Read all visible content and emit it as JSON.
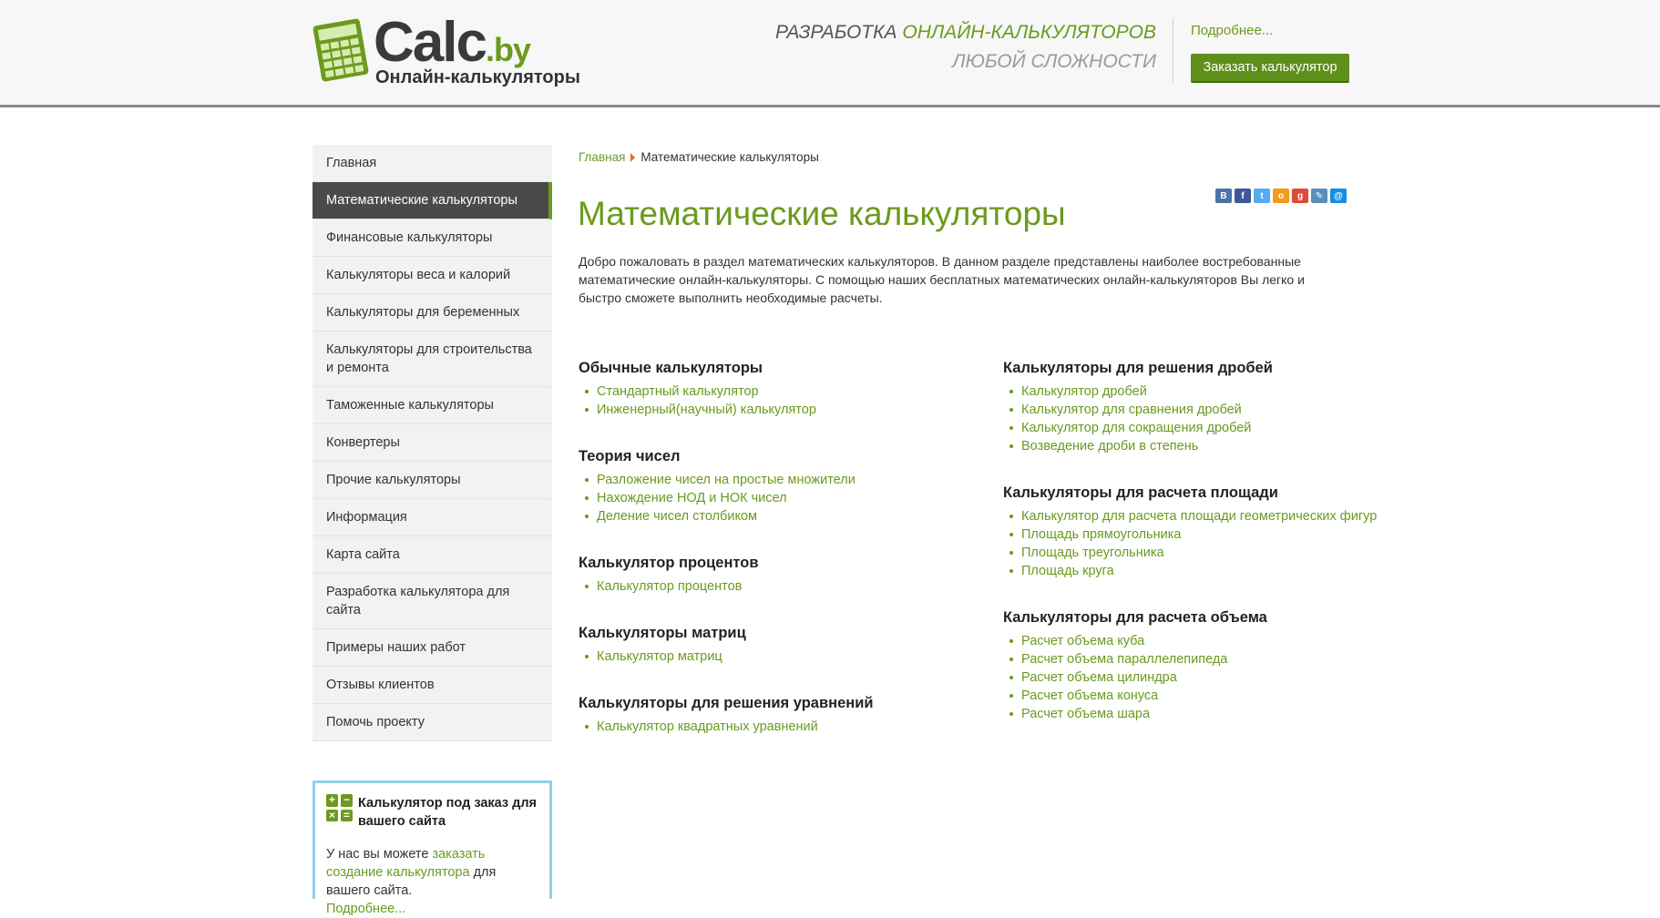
{
  "header": {
    "logo_main": "Calc",
    "logo_tld": ".by",
    "logo_sub": "Онлайн-калькуляторы",
    "slogan_part1": "Разработка ",
    "slogan_part2": "онлайн-калькуляторов",
    "slogan_line2": "любой сложности",
    "more_link": "Подробнее...",
    "order_button": "Заказать калькулятор"
  },
  "sidebar": {
    "items": [
      {
        "label": "Главная"
      },
      {
        "label": "Математические калькуляторы"
      },
      {
        "label": "Финансовые калькуляторы"
      },
      {
        "label": "Калькуляторы веса и калорий"
      },
      {
        "label": "Калькуляторы для беременных"
      },
      {
        "label": "Калькуляторы для строительства и ремонта"
      },
      {
        "label": "Таможенные калькуляторы"
      },
      {
        "label": "Конвертеры"
      },
      {
        "label": "Прочие калькуляторы"
      },
      {
        "label": "Информация"
      },
      {
        "label": "Карта сайта"
      },
      {
        "label": "Разработка калькулятора для сайта"
      },
      {
        "label": "Примеры наших работ"
      },
      {
        "label": "Отзывы клиентов"
      },
      {
        "label": "Помочь проекту"
      }
    ],
    "promo": {
      "title": "Калькулятор под заказ для вашего сайта",
      "text_before": "У нас вы можете ",
      "link": "заказать создание калькулятора",
      "text_after": " для вашего сайта.",
      "more": "Подробнее..."
    }
  },
  "breadcrumb": {
    "home": "Главная",
    "current": "Математические калькуляторы"
  },
  "share_icons": [
    {
      "icon": "vk-icon",
      "glyph": "В",
      "color": "#4c75a3"
    },
    {
      "icon": "facebook-icon",
      "glyph": "f",
      "color": "#3b5998"
    },
    {
      "icon": "twitter-icon",
      "glyph": "t",
      "color": "#55acee"
    },
    {
      "icon": "odnoklassniki-icon",
      "glyph": "o",
      "color": "#f59a1a"
    },
    {
      "icon": "googleplus-icon",
      "glyph": "g",
      "color": "#dd4b39"
    },
    {
      "icon": "livejournal-icon",
      "glyph": "✎",
      "color": "#5b8fb9"
    },
    {
      "icon": "mailru-icon",
      "glyph": "@",
      "color": "#168de2"
    }
  ],
  "main": {
    "title": "Математические калькуляторы",
    "intro": "Добро пожаловать в раздел математических калькуляторов. В данном разделе представлены наиболее востребованные математические онлайн-калькуляторы. С помощью наших бесплатных математических онлайн-калькуляторов Вы легко и быстро сможете выполнить необходимые расчеты.",
    "left_sections": [
      {
        "title": "Обычные калькуляторы",
        "links": [
          "Стандартный калькулятор",
          "Инженерный(научный) калькулятор"
        ]
      },
      {
        "title": "Теория чисел",
        "links": [
          "Разложение чисел на простые множители",
          "Нахождение НОД и НОК чисел",
          "Деление чисел столбиком"
        ]
      },
      {
        "title": "Калькулятор процентов",
        "links": [
          "Калькулятор процентов"
        ]
      },
      {
        "title": "Калькуляторы матриц",
        "links": [
          "Калькулятор матриц"
        ]
      },
      {
        "title": "Калькуляторы для решения уравнений",
        "links": [
          "Калькулятор квадратных уравнений"
        ]
      }
    ],
    "right_sections": [
      {
        "title": "Калькуляторы для решения дробей",
        "links": [
          "Калькулятор дробей",
          "Калькулятор для сравнения дробей",
          "Калькулятор для сокращения дробей",
          "Возведение дроби в степень"
        ]
      },
      {
        "title": "Калькуляторы для расчета площади",
        "links": [
          "Калькулятор для расчета площади геометрических фигур",
          "Площадь прямоугольника",
          "Площадь треугольника",
          "Площадь круга"
        ]
      },
      {
        "title": "Калькуляторы для расчета объема",
        "links": [
          "Расчет объема куба",
          "Расчет объема параллелепипеда",
          "Расчет объема цилиндра",
          "Расчет объема конуса",
          "Расчет объема шара"
        ]
      }
    ]
  }
}
